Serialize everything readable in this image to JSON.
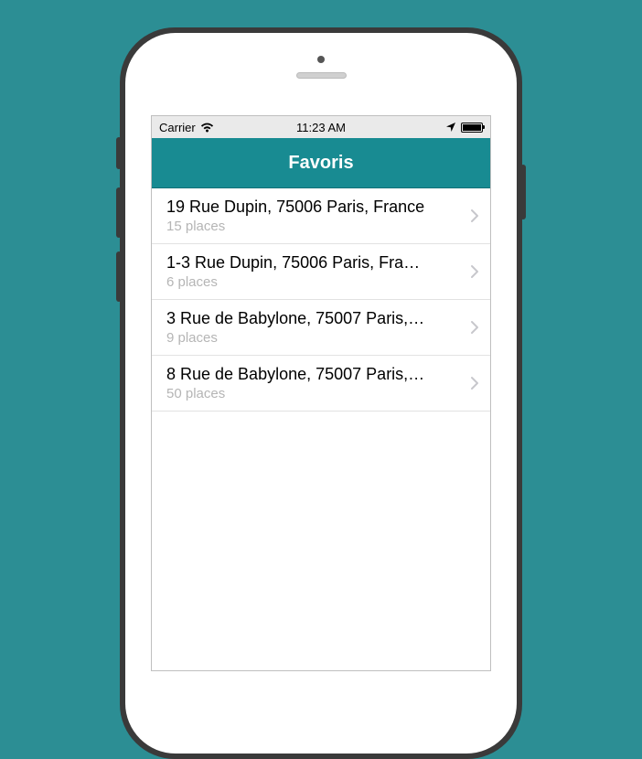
{
  "status": {
    "carrier": "Carrier",
    "time": "11:23 AM"
  },
  "nav": {
    "title": "Favoris"
  },
  "list": {
    "items": [
      {
        "title": "19 Rue Dupin, 75006 Paris, France",
        "subtitle": "15 places"
      },
      {
        "title": "1-3 Rue Dupin, 75006 Paris, Fra…",
        "subtitle": "6 places"
      },
      {
        "title": "3 Rue de Babylone, 75007 Paris,…",
        "subtitle": "9 places"
      },
      {
        "title": "8 Rue de Babylone, 75007 Paris,…",
        "subtitle": "50 places"
      }
    ]
  }
}
